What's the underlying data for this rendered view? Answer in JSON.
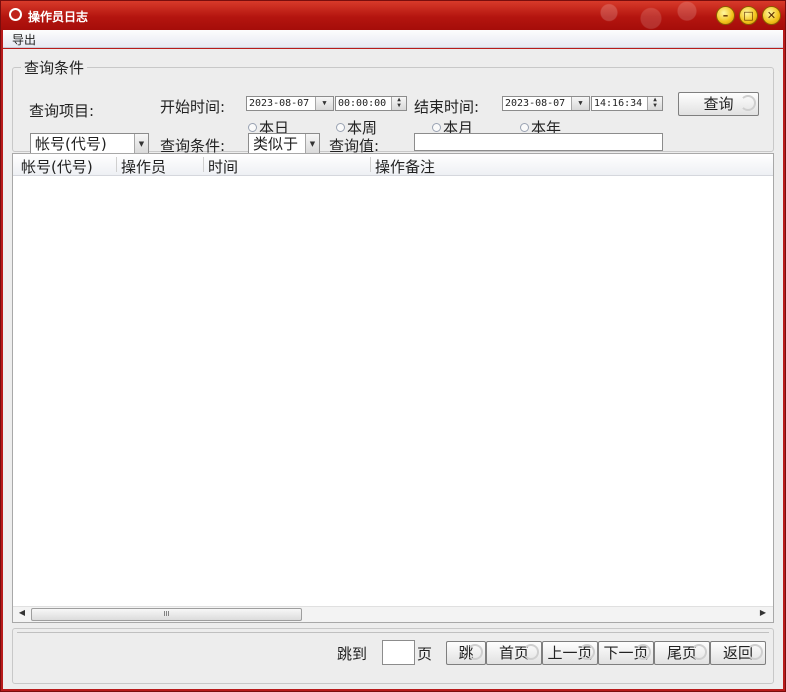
{
  "window": {
    "title": "操作员日志",
    "controls": {
      "minimize": "–",
      "maximize": "□",
      "close": "✕"
    }
  },
  "menu": {
    "items": [
      "导出"
    ]
  },
  "query": {
    "legend": "查询条件",
    "item_label": "查询项目:",
    "start_label": "开始时间:",
    "start_date": "2023-08-07",
    "start_time": "00:00:00",
    "end_label": "结束时间:",
    "end_date": "2023-08-07",
    "end_time": "14:16:34",
    "ranges": [
      "本日",
      "本周",
      "本月",
      "本年"
    ],
    "search_button": "查询",
    "field_select": "帐号(代号)",
    "condition_label": "查询条件:",
    "condition_select": "类似于",
    "value_label": "查询值:",
    "value": ""
  },
  "table": {
    "columns": [
      "帐号(代号)",
      "操作员",
      "时间",
      "操作备注"
    ],
    "rows": []
  },
  "scrollbar": {
    "thumb_grip": "III"
  },
  "pager": {
    "jump_label": "跳到",
    "page_value": "",
    "page_suffix": "页",
    "buttons": {
      "jump": "跳",
      "first": "首页",
      "prev": "上一页",
      "next": "下一页",
      "last": "尾页",
      "back": "返回"
    }
  }
}
